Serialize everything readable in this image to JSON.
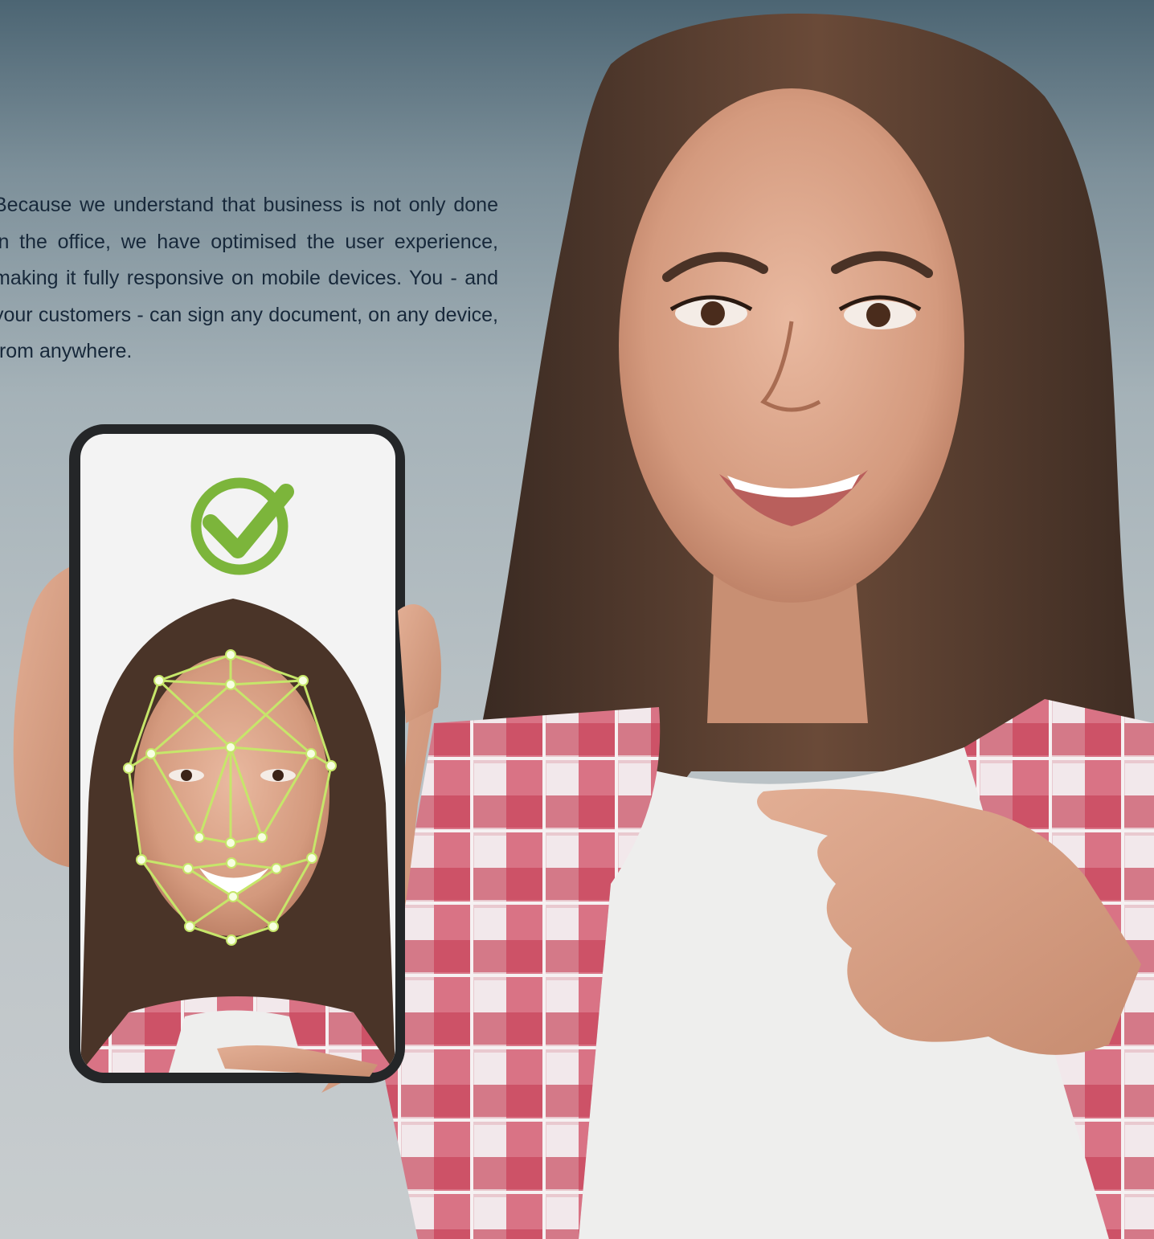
{
  "hero": {
    "paragraph": "Because we understand that business is not only done in the office, we have optimised the user experience, making it fully responsive on mobile devices. You - and your customers - can sign any document, on any device, from anywhere."
  },
  "photo": {
    "subject": "smiling-woman-pointing-at-phone-icon",
    "phone_status_icon": "checkmark-circle-icon",
    "phone_overlay": "face-recognition-mesh-icon"
  },
  "colors": {
    "text": "#17283a",
    "check_green": "#7cb53b",
    "mesh_green": "#c6e66a",
    "shirt_red": "#c8465e"
  }
}
